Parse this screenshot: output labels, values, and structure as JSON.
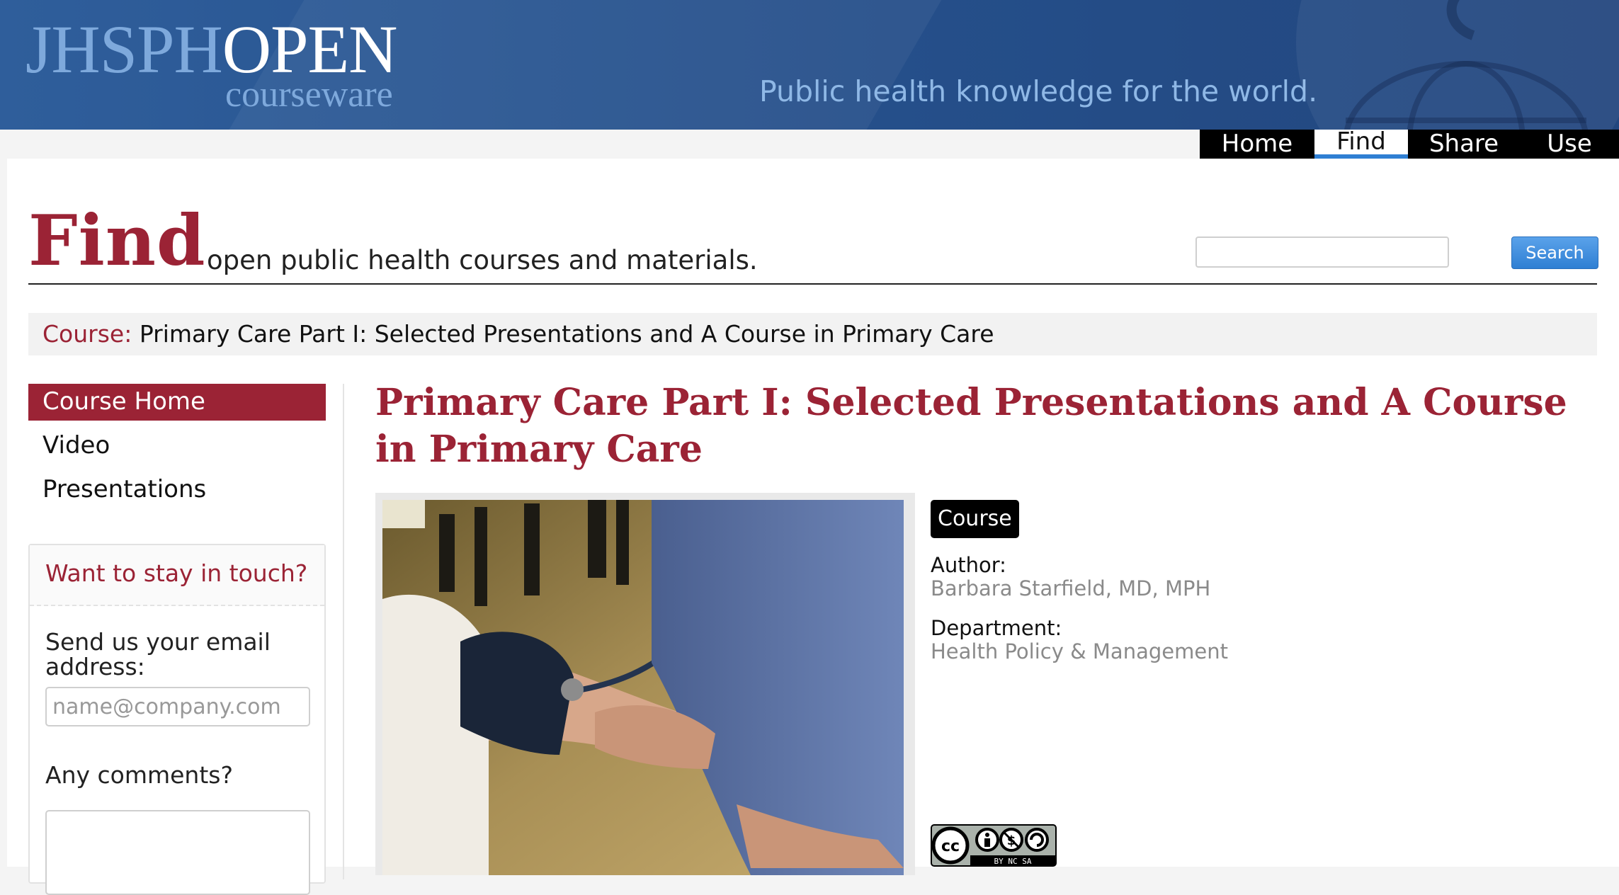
{
  "site": {
    "logo_primary": "JHSPH",
    "logo_secondary": "OPEN",
    "logo_sub": "courseware",
    "tagline": "Public health knowledge for the world."
  },
  "nav": {
    "items": [
      {
        "label": "Home",
        "active": false
      },
      {
        "label": "Find",
        "active": true
      },
      {
        "label": "Share",
        "active": false
      },
      {
        "label": "Use",
        "active": false
      }
    ]
  },
  "page_header": {
    "title": "Find",
    "subtitle": "open public health courses and materials.",
    "search_button": "Search",
    "search_value": ""
  },
  "breadcrumb": {
    "label": "Course:",
    "title": "Primary Care Part I: Selected Presentations and A Course in Primary Care"
  },
  "sidebar": {
    "items": [
      {
        "label": "Course Home",
        "active": true
      },
      {
        "label": "Video",
        "active": false
      },
      {
        "label": "Presentations",
        "active": false
      }
    ],
    "newsletter": {
      "heading": "Want to stay in touch?",
      "email_label": "Send us your email address:",
      "email_placeholder": "name@company.com",
      "comments_label": "Any comments?"
    }
  },
  "course": {
    "title": "Primary Care Part I: Selected Presentations and A Course in Primary Care",
    "type_badge": "Course",
    "author_label": "Author:",
    "author": "Barbara Starfield, MD, MPH",
    "department_label": "Department:",
    "department": "Health Policy & Management",
    "license_badge": "BY NC SA"
  },
  "colors": {
    "brand_red": "#9b2335",
    "banner_blue": "#2f5e9b",
    "accent_blue": "#2f7fd3",
    "nav_black": "#000000"
  }
}
